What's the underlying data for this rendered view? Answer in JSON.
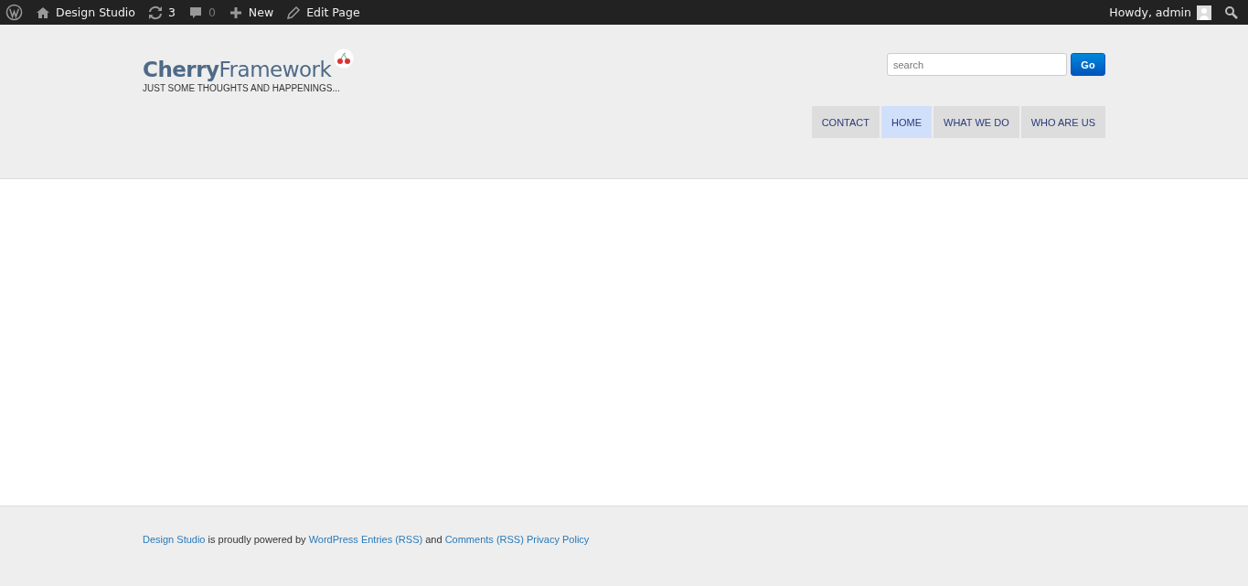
{
  "admin_bar": {
    "site": "Design Studio",
    "updates": "3",
    "comments": "0",
    "new": "New",
    "edit": "Edit Page",
    "greeting": "Howdy, admin"
  },
  "header": {
    "logo": "**Cherry**Framework",
    "tagline": "JUST SOME THOUGHTS AND HAPPENINGS...",
    "search": {
      "placeholder": "search",
      "button": "Go"
    },
    "nav": [
      {
        "label": "CONTACT",
        "selected": false
      },
      {
        "label": "HOME",
        "selected": true
      },
      {
        "label": "WHAT WE DO",
        "selected": false
      },
      {
        "label": "WHO ARE US",
        "selected": false
      }
    ]
  },
  "footer": [
    {
      "text": "Design Studio",
      "kind": "link"
    },
    {
      "text": "is proudly powered by",
      "kind": "text"
    },
    {
      "text": "WordPress",
      "kind": "link"
    },
    {
      "text": "Entries (RSS)",
      "kind": "link"
    },
    {
      "text": "and",
      "kind": "text"
    },
    {
      "text": "Comments (RSS)",
      "kind": "link"
    },
    {
      "text": "Privacy Policy",
      "kind": "link"
    }
  ]
}
